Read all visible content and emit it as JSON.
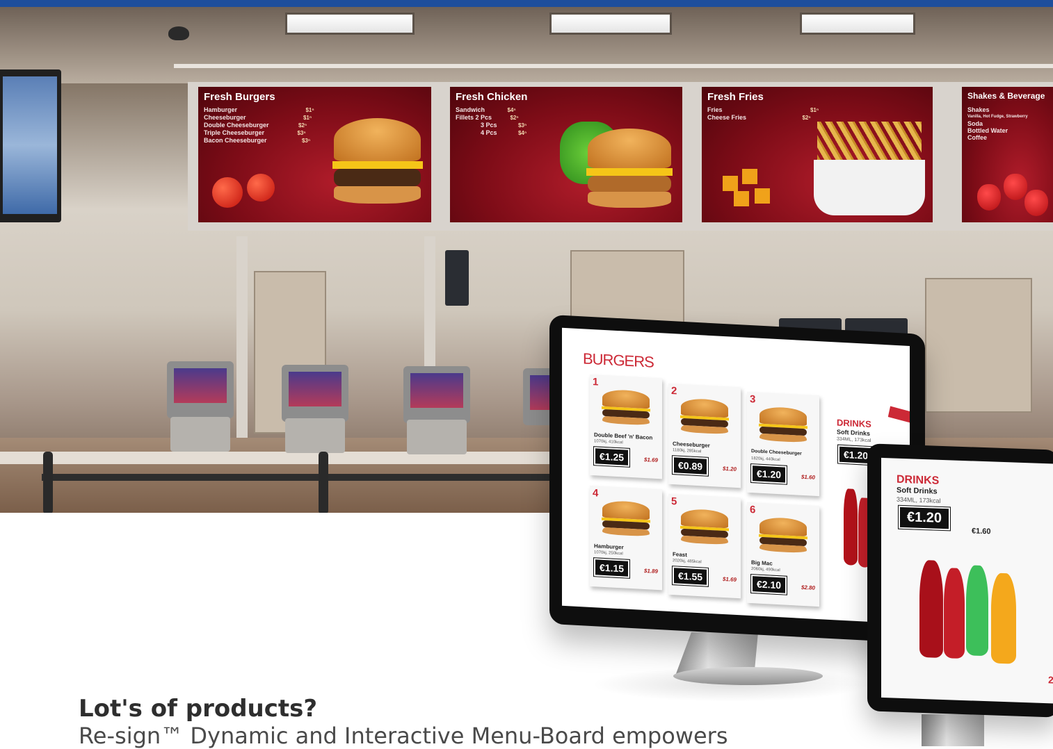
{
  "colors": {
    "brand_blue": "#1e4e9c",
    "accent_red": "#cc2936",
    "board_red": "#7d0c17"
  },
  "wall_menu_boards": [
    {
      "title": "Fresh Burgers",
      "items": [
        {
          "name": "Hamburger",
          "price": "$1ⁿ"
        },
        {
          "name": "Cheeseburger",
          "price": "$1ⁿ"
        },
        {
          "name": "Double Cheeseburger",
          "price": "$2ⁿ"
        },
        {
          "name": "Triple Cheeseburger",
          "price": "$3ⁿ"
        },
        {
          "name": "Bacon Cheeseburger",
          "price": "$3ⁿ"
        }
      ]
    },
    {
      "title": "Fresh Chicken",
      "items": [
        {
          "name": "Sandwich",
          "price": "$4ⁿ"
        },
        {
          "name": "Fillets 2 Pcs",
          "price": "$2ⁿ"
        },
        {
          "name": "3 Pcs",
          "price": "$3ⁿ"
        },
        {
          "name": "4 Pcs",
          "price": "$4ⁿ"
        }
      ]
    },
    {
      "title": "Fresh Fries",
      "items": [
        {
          "name": "Fries",
          "price": "$1ⁿ"
        },
        {
          "name": "Cheese Fries",
          "price": "$2ⁿ"
        }
      ]
    },
    {
      "title": "Shakes & Beverage",
      "items": [
        {
          "name": "Shakes",
          "price": ""
        },
        {
          "name": "Vanilla, Hot Fudge, Strawberry",
          "price": ""
        },
        {
          "name": "Soda",
          "price": ""
        },
        {
          "name": "Bottled Water",
          "price": ""
        },
        {
          "name": "Coffee",
          "price": ""
        }
      ]
    }
  ],
  "digital_menu": {
    "title": "BURGERS",
    "cards": [
      {
        "num": "1",
        "name": "Double Beef 'n' Bacon",
        "kcal": "1070kj, 410kcal",
        "price": "€1.25",
        "alt": "$1.69"
      },
      {
        "num": "2",
        "name": "Cheeseburger",
        "kcal": "1180kj, 285kcal",
        "price": "€0.89",
        "alt": "$1.20"
      },
      {
        "num": "3",
        "name": "Double Cheeseburger",
        "kcal": "1820kj, 440kcal",
        "price": "€1.20",
        "alt": "$1.60"
      },
      {
        "num": "4",
        "name": "Hamburger",
        "kcal": "1070kj, 250kcal",
        "price": "€1.15",
        "alt": "$1.89"
      },
      {
        "num": "5",
        "name": "Feast",
        "kcal": "2020kj, 485kcal",
        "price": "€1.55",
        "alt": "$1.69"
      },
      {
        "num": "6",
        "name": "Big Mac",
        "kcal": "2060kj, 490kcal",
        "price": "€2.10",
        "alt": "$2.80"
      }
    ],
    "drinks": {
      "label": "DRINKS",
      "sub": "Soft Drinks",
      "ml": "334ML, 173kcal",
      "price": "€1.20"
    }
  },
  "portrait_menu": {
    "label": "DRINKS",
    "sub": "Soft Drinks",
    "ml": "334ML, 173kcal",
    "price": "€1.20",
    "alt": "€1.60",
    "page": "2"
  },
  "headline": "Lot's of products?",
  "body": "Re-sign™ Dynamic and Interactive  Menu-Board empowers"
}
